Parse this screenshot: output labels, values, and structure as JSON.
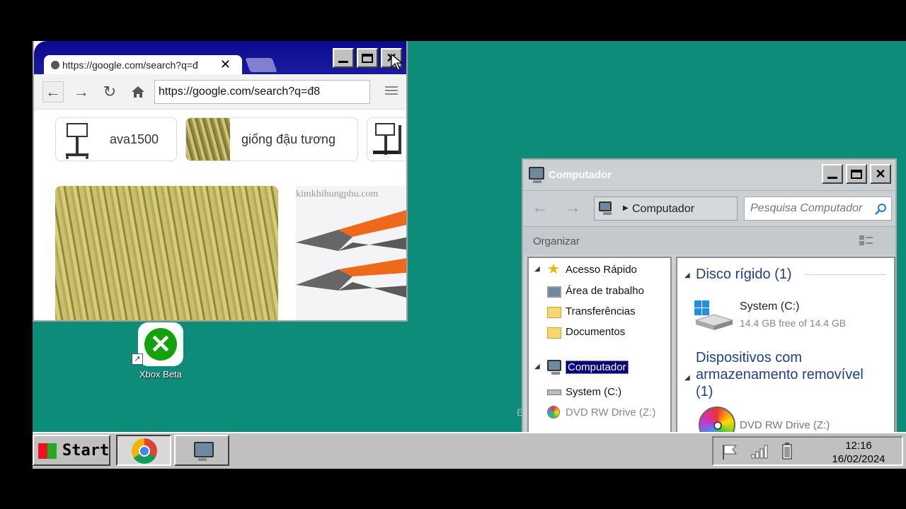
{
  "browser": {
    "tab_title": "https://google.com/search?q=đ",
    "url": "https://google.com/search?q=đ8",
    "chips": [
      {
        "label": "ava1500"
      },
      {
        "label": "giống đậu tương"
      }
    ],
    "image_watermark": "kimkhihungphu.com"
  },
  "desktop": {
    "icons": [
      {
        "label": "Xbox Beta"
      }
    ],
    "background_text": "E"
  },
  "explorer": {
    "title": "Computador",
    "address": "Computador",
    "search_placeholder": "Pesquisa Computador",
    "organize_label": "Organizar",
    "nav": {
      "quick_access": "Acesso Rápido",
      "desktop": "Área de trabalho",
      "downloads": "Transferências",
      "documents": "Documentos",
      "computer": "Computador",
      "system_drive": "System (C:)",
      "dvd_drive": "DVD RW Drive (Z:)"
    },
    "content": {
      "hard_disk_header": "Disco rígido (1)",
      "drive_name": "System (C:)",
      "drive_space": "14.4 GB free of 14.4 GB",
      "removable_header_line1": "Dispositivos com",
      "removable_header_line2": "armazenamento removível",
      "removable_header_line3": "(1)",
      "dvd_name": "DVD RW Drive (Z:)"
    }
  },
  "taskbar": {
    "start_label": "Start",
    "time": "12:16",
    "date": "16/02/2024"
  },
  "colors": {
    "desktop": "#0e8c7a",
    "browser_titlebar": "#0b0b8e",
    "explorer_section": "#1f3f8f",
    "selection": "#000080"
  }
}
